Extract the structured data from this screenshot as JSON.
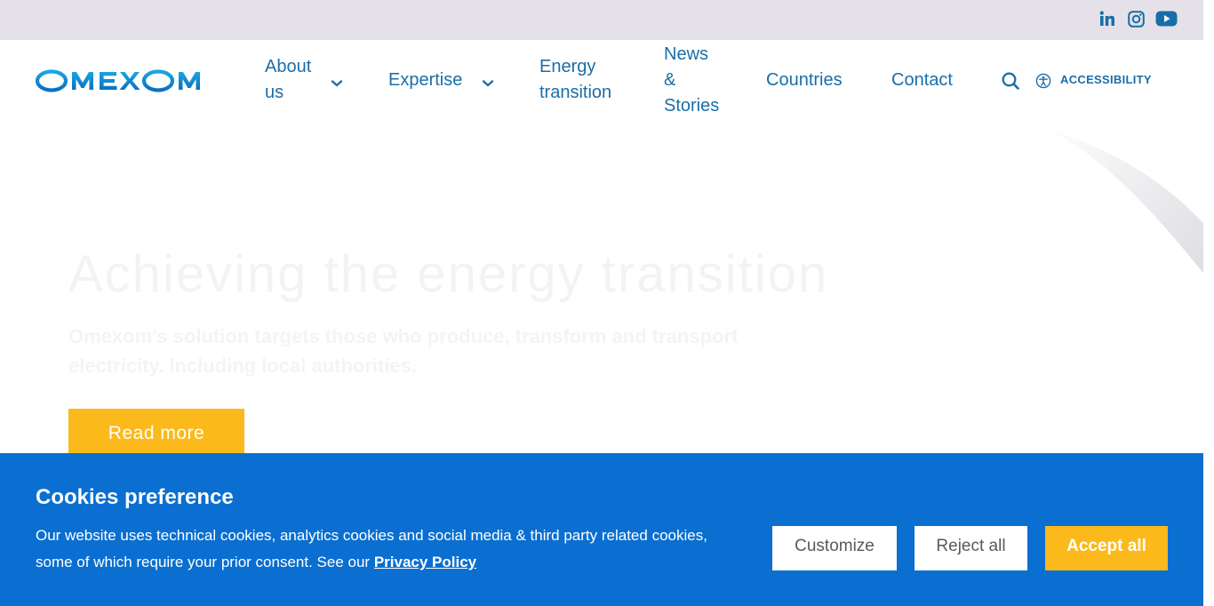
{
  "brand": {
    "name": "OMEXOM",
    "color": "#1a6ea8",
    "accent": "#0f97d4"
  },
  "social": [
    {
      "icon": "linkedin-icon"
    },
    {
      "icon": "instagram-icon"
    },
    {
      "icon": "youtube-icon"
    }
  ],
  "nav": {
    "about": "About us",
    "expertise": "Expertise",
    "energy": "Energy transition",
    "news": "News & Stories",
    "countries": "Countries",
    "contact": "Contact",
    "accessibility": "ACCESSIBILITY"
  },
  "hero": {
    "title": "Achieving the energy transition",
    "subtitle": "Omexom's solution targets those who produce, transform and transport electricity. Including local authorities.",
    "cta": "Read more"
  },
  "cookies": {
    "title": "Cookies preference",
    "text": "Our website uses technical cookies, analytics cookies and social media & third party related cookies, some of which require your prior consent. See our ",
    "link": "Privacy Policy",
    "customize": "Customize",
    "reject": "Reject all",
    "accept": "Accept all"
  },
  "colors": {
    "banner": "#0a6fd1",
    "button_yellow": "#fbb91c",
    "topbar": "#e4e2e8"
  }
}
